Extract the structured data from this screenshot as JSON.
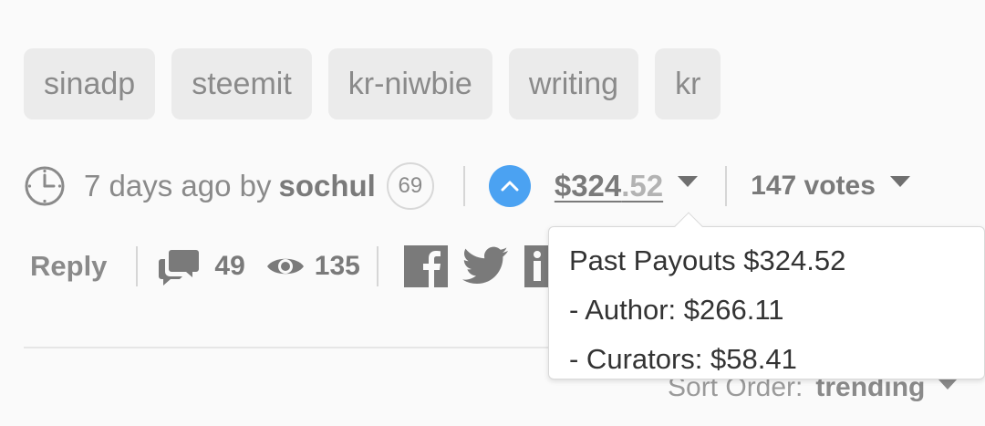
{
  "tags": [
    "sinadp",
    "steemit",
    "kr-niwbie",
    "writing",
    "kr"
  ],
  "meta": {
    "time_ago_by": "7 days ago by",
    "author": "sochul",
    "reputation": "69",
    "payout_whole": "$324",
    "payout_cents": ".52",
    "votes": "147 votes"
  },
  "actions": {
    "reply": "Reply",
    "comments": "49",
    "views": "135"
  },
  "sort": {
    "label": "Sort Order:",
    "value": "trending"
  },
  "tooltip": {
    "line1": "Past Payouts $324.52",
    "line2": "- Author: $266.11",
    "line3": "- Curators: $58.41"
  },
  "colors": {
    "upvote": "#4ba2f2",
    "tag_bg": "#ebebeb",
    "text_muted": "#8a8a8a",
    "tooltip_text": "#333333"
  },
  "icons": [
    "clock-icon",
    "upvote-icon",
    "caret-down-icon",
    "comments-icon",
    "eye-icon",
    "facebook-icon",
    "twitter-icon",
    "linkedin-icon"
  ]
}
